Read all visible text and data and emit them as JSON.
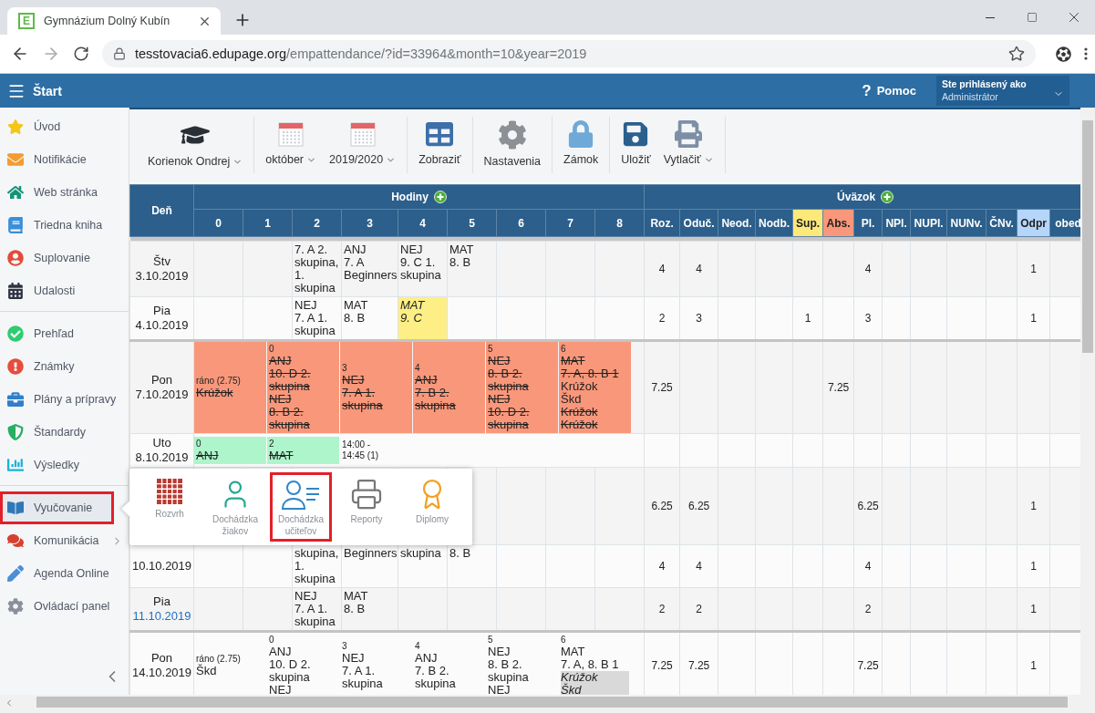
{
  "browser": {
    "tab": {
      "favicon": "E",
      "title": "Gymnázium Dolný Kubín"
    },
    "url": {
      "host": "tesstovacia6.edupage.org",
      "path": "/empattendance/?id=33964&month=10&year=2019"
    }
  },
  "header": {
    "title": "Štart",
    "help": {
      "icon": "?",
      "label": "Pomoc"
    },
    "user": {
      "caption": "Ste prihlásený ako",
      "name": "Administrátor"
    }
  },
  "sidebar": {
    "sections": [
      {
        "items": [
          {
            "label": "Úvod",
            "selected": false,
            "highlighted": false,
            "chevron": false
          },
          {
            "label": "Notifikácie",
            "selected": false,
            "highlighted": false,
            "chevron": false
          },
          {
            "label": "Web stránka",
            "selected": false,
            "highlighted": false,
            "chevron": false
          },
          {
            "label": "Triedna kniha",
            "selected": false,
            "highlighted": false,
            "chevron": false
          },
          {
            "label": "Suplovanie",
            "selected": false,
            "highlighted": false,
            "chevron": false
          },
          {
            "label": "Udalosti",
            "selected": false,
            "highlighted": false,
            "chevron": false
          }
        ]
      },
      {
        "items": [
          {
            "label": "Prehľad",
            "selected": false,
            "highlighted": false,
            "chevron": false
          },
          {
            "label": "Známky",
            "selected": false,
            "highlighted": false,
            "chevron": false
          },
          {
            "label": "Plány a prípravy",
            "selected": false,
            "highlighted": false,
            "chevron": false
          },
          {
            "label": "Štandardy",
            "selected": false,
            "highlighted": false,
            "chevron": false
          },
          {
            "label": "Výsledky",
            "selected": false,
            "highlighted": false,
            "chevron": false
          }
        ]
      },
      {
        "items": [
          {
            "label": "Vyučovanie",
            "selected": true,
            "highlighted": true,
            "chevron": false
          },
          {
            "label": "Komunikácia",
            "selected": false,
            "highlighted": false,
            "chevron": true
          },
          {
            "label": "Agenda Online",
            "selected": false,
            "highlighted": false,
            "chevron": false
          },
          {
            "label": "Ovládací panel",
            "selected": false,
            "highlighted": false,
            "chevron": false
          }
        ]
      }
    ]
  },
  "toolbar": {
    "groups": [
      {
        "buttons": [
          {
            "label": "Korienok Ondrej",
            "dropdown": true
          }
        ]
      },
      {
        "buttons": [
          {
            "label": "október",
            "dropdown": true
          },
          {
            "label": "2019/2020",
            "dropdown": true
          }
        ]
      },
      {
        "buttons": [
          {
            "label": "Zobraziť",
            "dropdown": false
          }
        ]
      },
      {
        "buttons": [
          {
            "label": "Nastavenia",
            "dropdown": false
          }
        ]
      },
      {
        "buttons": [
          {
            "label": "Zámok",
            "dropdown": false
          }
        ]
      },
      {
        "buttons": [
          {
            "label": "Uložiť",
            "dropdown": false
          },
          {
            "label": "Vytlačiť",
            "dropdown": true
          }
        ]
      }
    ]
  },
  "table": {
    "day_label": "Deň",
    "hours": {
      "label": "Hodiny",
      "columns": [
        "0",
        "1",
        "2",
        "3",
        "4",
        "5",
        "6",
        "7",
        "8"
      ]
    },
    "totals": {
      "label": "Úväzok",
      "columns": [
        {
          "label": "Roz."
        },
        {
          "label": "Oduč."
        },
        {
          "label": "Neod."
        },
        {
          "label": "Nodb."
        },
        {
          "label": "Sup.",
          "color": "#fde97a"
        },
        {
          "label": "Abs.",
          "color": "#f9977a"
        },
        {
          "label": "Pl."
        },
        {
          "label": "NPl."
        },
        {
          "label": "NUPl."
        },
        {
          "label": "NUNv."
        },
        {
          "label": "ČNv."
        },
        {
          "label": "Odpr",
          "color": "#b5d5fb"
        },
        {
          "label": "obed"
        }
      ]
    },
    "rows": [
      {
        "kind": "grid",
        "new_week": false,
        "today": false,
        "day": [
          "Štv",
          "3.10.2019"
        ],
        "cells": {
          "hour_2": {
            "lines": [
              {
                "text": "7. A 2.",
                "kind": "plain"
              },
              {
                "text": "skupina,",
                "kind": "plain"
              },
              {
                "text": "1.",
                "kind": "plain"
              },
              {
                "text": "skupina",
                "kind": "plain"
              }
            ]
          },
          "hour_3": {
            "lines": [
              {
                "text": "ANJ",
                "kind": "plain"
              },
              {
                "text": "7. A",
                "kind": "plain"
              },
              {
                "text": "Beginners",
                "kind": "plain"
              }
            ]
          },
          "hour_4": {
            "lines": [
              {
                "text": "NEJ",
                "kind": "plain"
              },
              {
                "text": "9. C 1.",
                "kind": "plain"
              },
              {
                "text": "skupina",
                "kind": "plain"
              }
            ]
          },
          "hour_5": {
            "lines": [
              {
                "text": "MAT",
                "kind": "plain"
              },
              {
                "text": "8. B",
                "kind": "plain"
              }
            ]
          }
        },
        "totals": {
          "roz": "4",
          "oduc": "4",
          "pl": "4",
          "odpr": "1"
        }
      },
      {
        "kind": "grid",
        "new_week": false,
        "today": false,
        "day": [
          "Pia",
          "4.10.2019"
        ],
        "cells": {
          "hour_2": {
            "lines": [
              {
                "text": "NEJ",
                "kind": "plain"
              },
              {
                "text": "7. A 1.",
                "kind": "plain"
              },
              {
                "text": "skupina",
                "kind": "plain"
              }
            ]
          },
          "hour_3": {
            "lines": [
              {
                "text": "MAT",
                "kind": "plain"
              },
              {
                "text": "8. B",
                "kind": "plain"
              }
            ]
          },
          "hour_4": {
            "color": "#fdef86",
            "lines": [
              {
                "text": "MAT",
                "kind": "italic"
              },
              {
                "text": "9. C",
                "kind": "italic"
              }
            ]
          }
        },
        "totals": {
          "roz": "2",
          "oduc": "3",
          "sup": "1",
          "pl": "3",
          "odpr": "1"
        }
      },
      {
        "kind": "blocks",
        "new_week": true,
        "today": false,
        "day": [
          "Pon",
          "7.10.2019"
        ],
        "blocks": [
          {
            "color": "#f9977a",
            "lines": [
              {
                "text": "ráno (2.75)",
                "kind": "period"
              },
              {
                "text": "Krúžok",
                "kind": "struck"
              }
            ]
          },
          {
            "color": "#f9977a",
            "lines": [
              {
                "text": "0",
                "kind": "period"
              },
              {
                "text": "ANJ",
                "kind": "struck"
              },
              {
                "text": "10. D 2.",
                "kind": "struck"
              },
              {
                "text": "skupina",
                "kind": "struck"
              },
              {
                "text": "NEJ",
                "kind": "struck"
              },
              {
                "text": "8. B 2.",
                "kind": "struck"
              },
              {
                "text": "skupina",
                "kind": "struck"
              }
            ]
          },
          {
            "color": "#f9977a",
            "lines": [
              {
                "text": "3",
                "kind": "period"
              },
              {
                "text": "NEJ",
                "kind": "struck"
              },
              {
                "text": "7. A 1.",
                "kind": "struck"
              },
              {
                "text": "skupina",
                "kind": "struck"
              }
            ]
          },
          {
            "color": "#f9977a",
            "lines": [
              {
                "text": "4",
                "kind": "period"
              },
              {
                "text": "ANJ",
                "kind": "struck"
              },
              {
                "text": "7. B 2.",
                "kind": "struck"
              },
              {
                "text": "skupina",
                "kind": "struck"
              }
            ]
          },
          {
            "color": "#f9977a",
            "lines": [
              {
                "text": "5",
                "kind": "period"
              },
              {
                "text": "NEJ",
                "kind": "struck"
              },
              {
                "text": "8. B 2.",
                "kind": "struck"
              },
              {
                "text": "skupina",
                "kind": "struck"
              },
              {
                "text": "NEJ",
                "kind": "struck"
              },
              {
                "text": "10. D 2.",
                "kind": "struck"
              },
              {
                "text": "skupina",
                "kind": "struck"
              }
            ]
          },
          {
            "color": "#f9977a",
            "lines": [
              {
                "text": "6",
                "kind": "period"
              },
              {
                "text": "MAT",
                "kind": "struck"
              },
              {
                "text": "7. A, 8. B 1",
                "kind": "struck"
              },
              {
                "text": "Krúžok",
                "kind": "plain"
              },
              {
                "text": "Škd",
                "kind": "plain"
              },
              {
                "text": "Krúžok",
                "kind": "struck"
              },
              {
                "text": "Krúžok",
                "kind": "struck"
              }
            ]
          }
        ],
        "totals": {
          "roz": "7.25",
          "abs": "7.25"
        }
      },
      {
        "kind": "blocks",
        "new_week": false,
        "today": false,
        "day": [
          "Uto",
          "8.10.2019"
        ],
        "blocks": [
          {
            "color": "#aef5cc",
            "lines": [
              {
                "text": "0",
                "kind": "period"
              },
              {
                "text": "ANJ",
                "kind": "struck"
              }
            ]
          },
          {
            "color": "#aef5cc",
            "lines": [
              {
                "text": "2",
                "kind": "period"
              },
              {
                "text": "MAT",
                "kind": "struck"
              }
            ]
          },
          {
            "lines": [
              {
                "text": "14:00 -",
                "kind": "period"
              },
              {
                "text": "14:45 (1)",
                "kind": "period"
              }
            ]
          }
        ]
      },
      {
        "kind": "grid",
        "new_week": false,
        "totals": {
          "roz": "6.25",
          "oduc": "6.25",
          "pl": "6.25",
          "odpr": "1"
        }
      },
      {
        "kind": "grid",
        "new_week": false,
        "today": false,
        "day": [
          "10.10.2019"
        ],
        "cells": {
          "hour_2": {
            "lines": [
              {
                "text": "skupina,",
                "kind": "plain"
              },
              {
                "text": "1.",
                "kind": "plain"
              },
              {
                "text": "skupina",
                "kind": "plain"
              }
            ]
          },
          "hour_3": {
            "lines": [
              {
                "text": "Beginners",
                "kind": "plain"
              }
            ]
          },
          "hour_4": {
            "lines": [
              {
                "text": "skupina",
                "kind": "plain"
              }
            ]
          },
          "hour_5": {
            "lines": [
              {
                "text": "8. B",
                "kind": "plain"
              }
            ]
          }
        },
        "totals": {
          "roz": "4",
          "oduc": "4",
          "pl": "4",
          "odpr": "1"
        }
      },
      {
        "kind": "grid",
        "new_week": false,
        "today": true,
        "day": [
          "Pia",
          "11.10.2019"
        ],
        "cells": {
          "hour_2": {
            "lines": [
              {
                "text": "NEJ",
                "kind": "plain"
              },
              {
                "text": "7. A 1.",
                "kind": "plain"
              },
              {
                "text": "skupina",
                "kind": "plain"
              }
            ]
          },
          "hour_3": {
            "lines": [
              {
                "text": "MAT",
                "kind": "plain"
              },
              {
                "text": "8. B",
                "kind": "plain"
              }
            ]
          }
        },
        "totals": {
          "roz": "2",
          "oduc": "2",
          "pl": "2",
          "odpr": "1"
        }
      },
      {
        "kind": "blocks",
        "new_week": true,
        "today": false,
        "day": [
          "Pon",
          "14.10.2019"
        ],
        "blocks": [
          {
            "lines": [
              {
                "text": "ráno (2.75)",
                "kind": "period"
              },
              {
                "text": "Škd",
                "kind": "plain"
              }
            ]
          },
          {
            "lines": [
              {
                "text": "0",
                "kind": "period"
              },
              {
                "text": "ANJ",
                "kind": "plain"
              },
              {
                "text": "10. D 2.",
                "kind": "plain"
              },
              {
                "text": "skupina",
                "kind": "plain"
              },
              {
                "text": "NEJ",
                "kind": "plain"
              }
            ]
          },
          {
            "lines": [
              {
                "text": "3",
                "kind": "period"
              },
              {
                "text": "NEJ",
                "kind": "plain"
              },
              {
                "text": "7. A 1.",
                "kind": "plain"
              },
              {
                "text": "skupina",
                "kind": "plain"
              }
            ]
          },
          {
            "lines": [
              {
                "text": "4",
                "kind": "period"
              },
              {
                "text": "ANJ",
                "kind": "plain"
              },
              {
                "text": "7. B 2.",
                "kind": "plain"
              },
              {
                "text": "skupina",
                "kind": "plain"
              }
            ]
          },
          {
            "lines": [
              {
                "text": "5",
                "kind": "period"
              },
              {
                "text": "NEJ",
                "kind": "plain"
              },
              {
                "text": "8. B 2.",
                "kind": "plain"
              },
              {
                "text": "skupina",
                "kind": "plain"
              },
              {
                "text": "NEJ",
                "kind": "plain"
              }
            ]
          },
          {
            "lines": [
              {
                "text": "6",
                "kind": "period"
              },
              {
                "text": "MAT",
                "kind": "plain"
              },
              {
                "text": "7. A, 8. B 1",
                "kind": "plain"
              },
              {
                "text": "Krúžok",
                "kind": "marked"
              },
              {
                "text": "Škd",
                "kind": "marked"
              }
            ]
          }
        ],
        "totals": {
          "roz": "7.25",
          "oduc": "7.25",
          "pl": "7.25",
          "odpr": "1"
        }
      }
    ]
  },
  "menu_popup": {
    "items": [
      {
        "label": "Rozvrh",
        "highlighted": false
      },
      {
        "label": "Dochádzka žiakov",
        "highlighted": false
      },
      {
        "label": "Dochádzka učiteľov",
        "highlighted": true
      },
      {
        "label": "Reporty",
        "highlighted": false
      },
      {
        "label": "Diplomy",
        "highlighted": false
      }
    ]
  }
}
